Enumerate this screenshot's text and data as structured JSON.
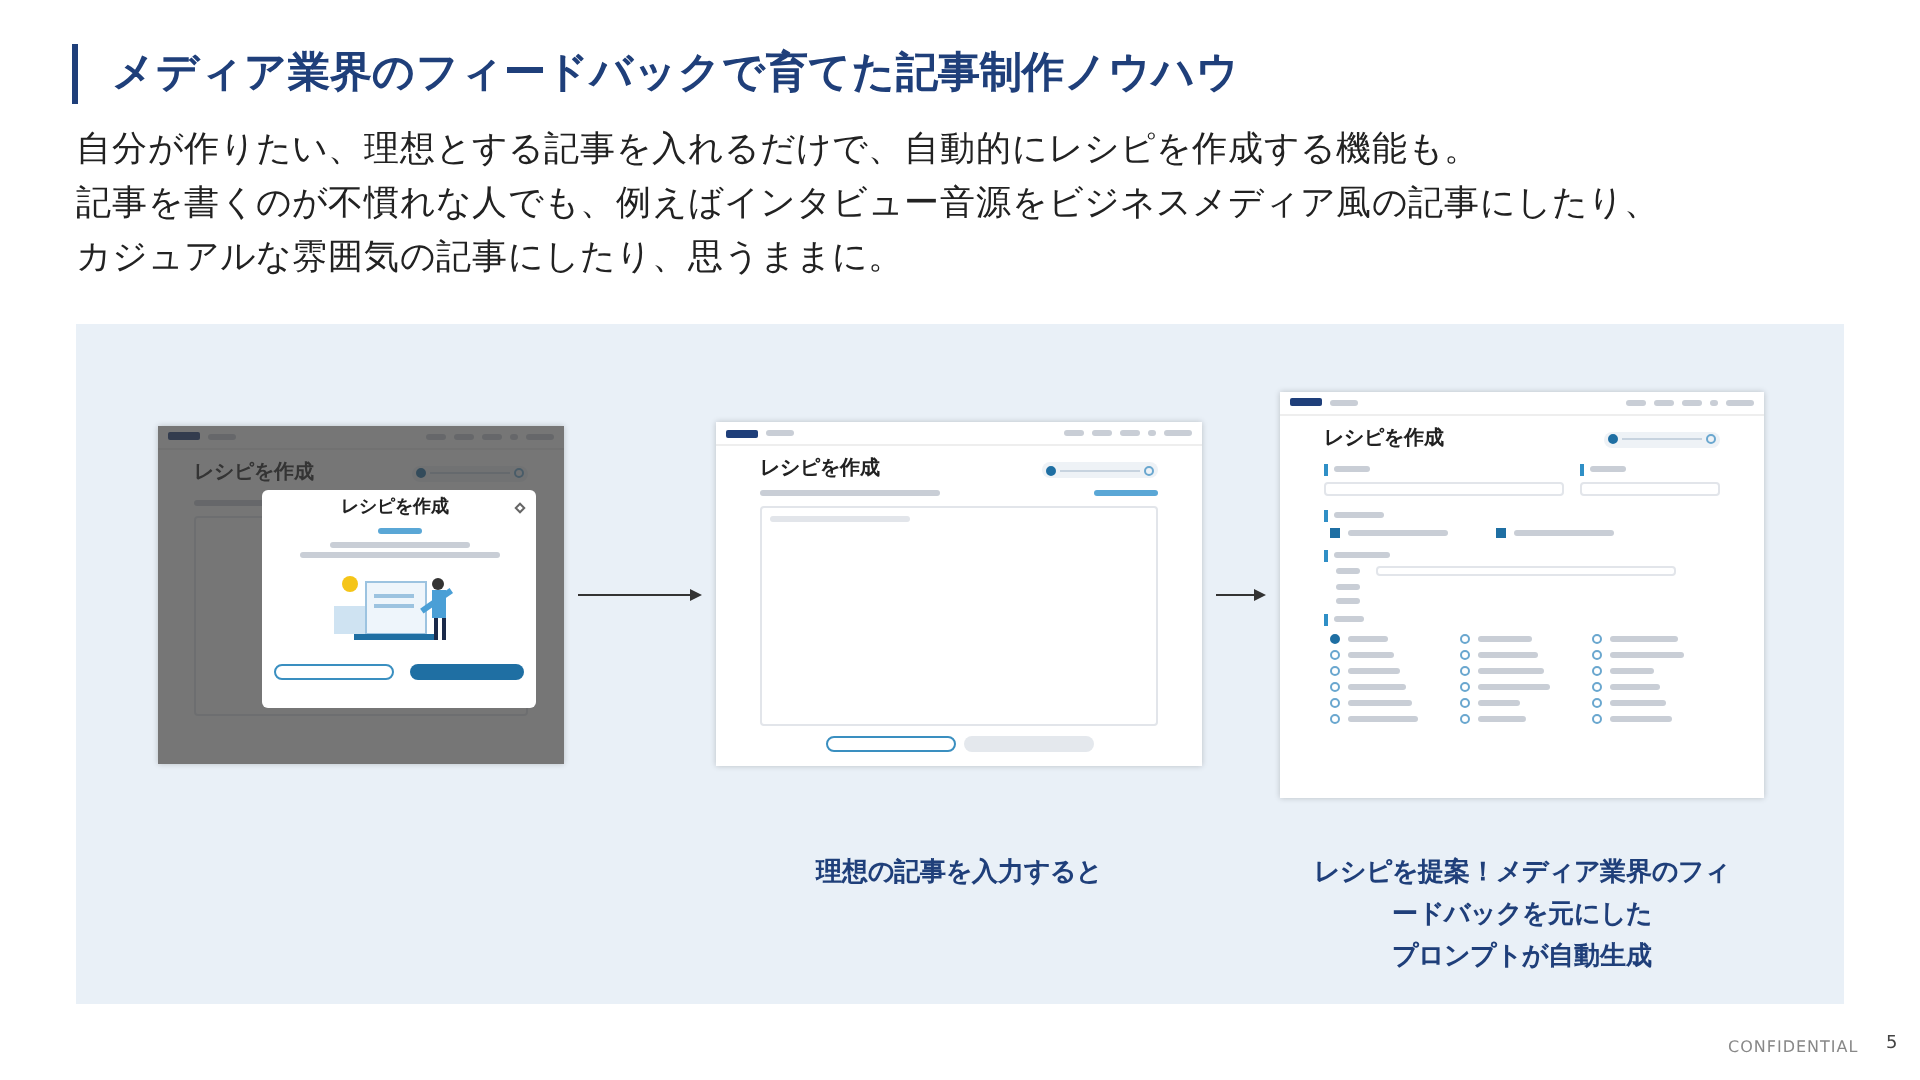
{
  "header": {
    "title": "メディア業界のフィードバックで育てた記事制作ノウハウ"
  },
  "description": [
    "自分が作りたい、理想とする記事を入れるだけで、自動的にレシピを作成する機能も。",
    "記事を書くのが不慣れな人でも、例えばインタビュー音源をビジネスメディア風の記事にしたり、",
    "カジュアルな雰囲気の記事にしたり、思うままに。"
  ],
  "flow": {
    "steps": [
      {
        "kind": "modal",
        "screen_title": "レシピを作成",
        "modal_title": "レシピを作成"
      },
      {
        "kind": "input",
        "screen_title": "レシピを作成",
        "caption": [
          "理想の記事を入力すると"
        ]
      },
      {
        "kind": "form",
        "screen_title": "レシピを作成",
        "checkboxes": [
          {
            "checked": true
          },
          {
            "checked": true
          }
        ],
        "radios": [
          {
            "selected": true
          },
          {
            "selected": false
          },
          {
            "selected": false
          },
          {
            "selected": false
          },
          {
            "selected": false
          },
          {
            "selected": false
          },
          {
            "selected": false
          },
          {
            "selected": false
          },
          {
            "selected": false
          },
          {
            "selected": false
          },
          {
            "selected": false
          },
          {
            "selected": false
          },
          {
            "selected": false
          },
          {
            "selected": false
          },
          {
            "selected": false
          },
          {
            "selected": false
          },
          {
            "selected": false
          },
          {
            "selected": false
          }
        ],
        "caption": [
          "レシピを提案！メディア業界のフィ",
          "ードバックを元にした",
          "プロンプトが自動生成"
        ]
      }
    ]
  },
  "footer": {
    "label": "CONFIDENTIAL",
    "page_number": "5"
  }
}
